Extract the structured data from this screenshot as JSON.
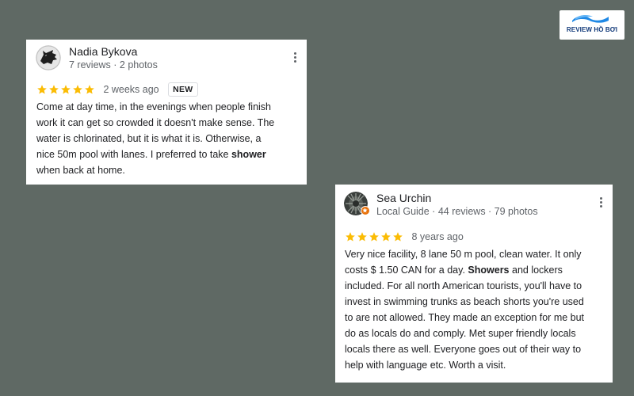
{
  "logo": {
    "text": "REVIEW HỒ BƠI"
  },
  "colors": {
    "background": "#5f6964",
    "star": "#fbbc04",
    "badge": "#e8710a"
  },
  "reviews": [
    {
      "author": "Nadia Bykova",
      "meta": "7 reviews · 2 photos",
      "rating": 5,
      "time": "2 weeks ago",
      "badge": "NEW",
      "lines": [
        [
          "Come at day time, in the evenings when people finish"
        ],
        [
          "work it can get so crowded it doesn't make sense. The"
        ],
        [
          "water is chlorinated, but it is what it is. Otherwise, a"
        ],
        [
          "nice 50m pool with lanes. I preferred to take ",
          "shower"
        ],
        [
          "when back at home."
        ]
      ],
      "avatar_icon": "wolf-avatar-icon"
    },
    {
      "author": "Sea Urchin",
      "meta": "Local Guide · 44 reviews · 79 photos",
      "rating": 5,
      "time": "8 years ago",
      "lines": [
        [
          "Very nice facility, 8 lane 50 m pool, clean water. It only"
        ],
        [
          "costs $ 1.50 CAN for a day. ",
          "Showers",
          " and lockers"
        ],
        [
          "included. For all north American tourists, you'll have to"
        ],
        [
          "invest in swimming trunks as beach shorts you're used"
        ],
        [
          "to are not allowed. They made an exception for me but"
        ],
        [
          "do as locals do and comply. Met super friendly locals"
        ],
        [
          "locals there as well. Everyone goes out of their way to"
        ],
        [
          "help with language etc. Worth a visit."
        ]
      ],
      "avatar_icon": "sea-urchin-avatar-icon"
    }
  ]
}
